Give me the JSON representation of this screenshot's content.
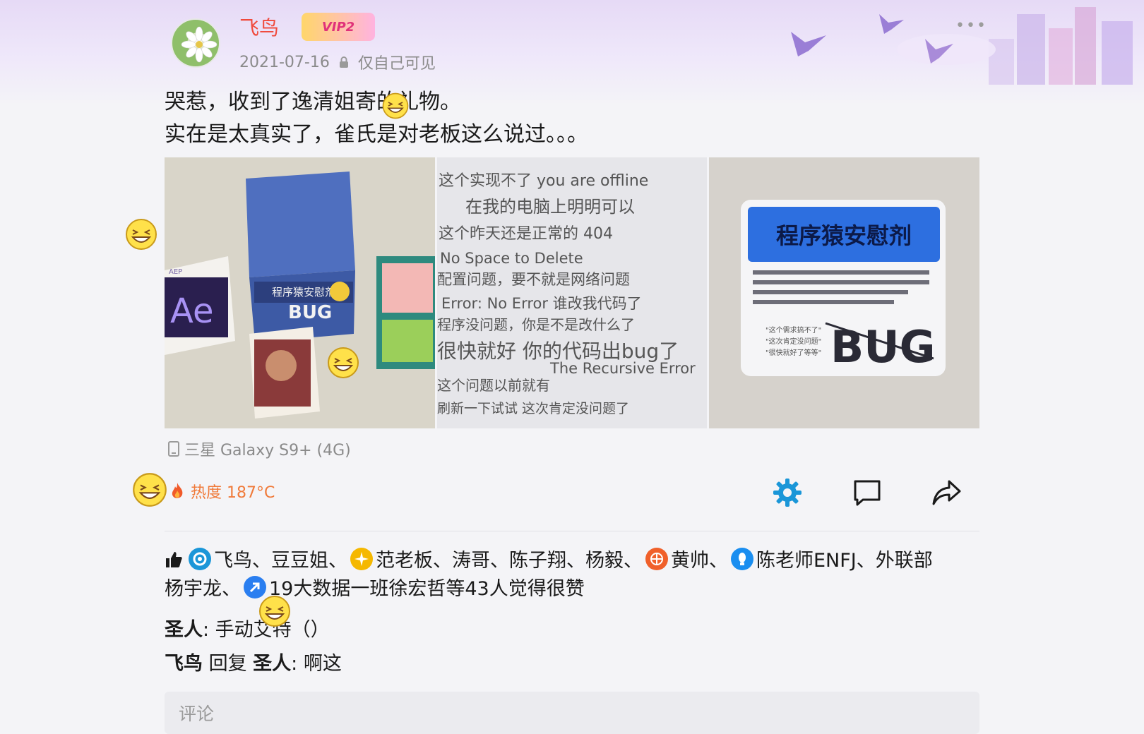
{
  "user": {
    "name": "飞鸟",
    "vip_label": "VIP2",
    "date": "2021-07-16",
    "visibility": "仅自己可见"
  },
  "menu_icon": "more-dots-icon",
  "post": {
    "lines": [
      "哭惹，收到了逸清姐寄的礼物。",
      "实在是太真实了，雀氏是对老板这么说过。。。"
    ]
  },
  "photos": {
    "photo1": {
      "card_title": "程序猿安慰剂",
      "box_word": "BUG",
      "logo": "Ae",
      "logo_tag": "AEP"
    },
    "photo2": {
      "lines": [
        "这个实现不了  you are offline",
        "在我的电脑上明明可以",
        "这个昨天还是正常的   404",
        "No Space to Delete",
        "配置问题，要不就是网络问题",
        "Error: No Error   谁改我代码了",
        "程序没问题，你是不是改什么了",
        "很快就好  你的代码出bug了",
        "The Recursive Error",
        "这个问题以前就有",
        "刷新一下试试  这次肯定没问题了"
      ]
    },
    "photo3": {
      "title": "程序猿安慰剂",
      "word": "BUG",
      "quote1": "\"这个需求搞不了\"",
      "quote2": "\"这次肯定没问题\"",
      "quote3": "\"很快就好了等等\""
    }
  },
  "device": "三星 Galaxy S9+ (4G)",
  "heat": "热度 187°C",
  "likes": {
    "text_a": "飞鸟、豆豆姐、",
    "text_b": "范老板、涛哥、陈子翔、杨毅、",
    "text_c": "黄帅、",
    "text_d": "陈老师ENFJ、外联部",
    "text_e": "杨宇龙、",
    "text_f": "19大数据一班徐宏哲等43人觉得很赞"
  },
  "comments": [
    {
      "author": "圣人",
      "text": ": 手动艾特（）"
    },
    {
      "author": "飞鸟",
      "reply_word": " 回复 ",
      "target": "圣人",
      "text": ": 啊这"
    }
  ],
  "comment_placeholder": "评论",
  "colors": {
    "username": "#f04a3c",
    "heat": "#f07a3a",
    "accent": "#1a96d8"
  }
}
